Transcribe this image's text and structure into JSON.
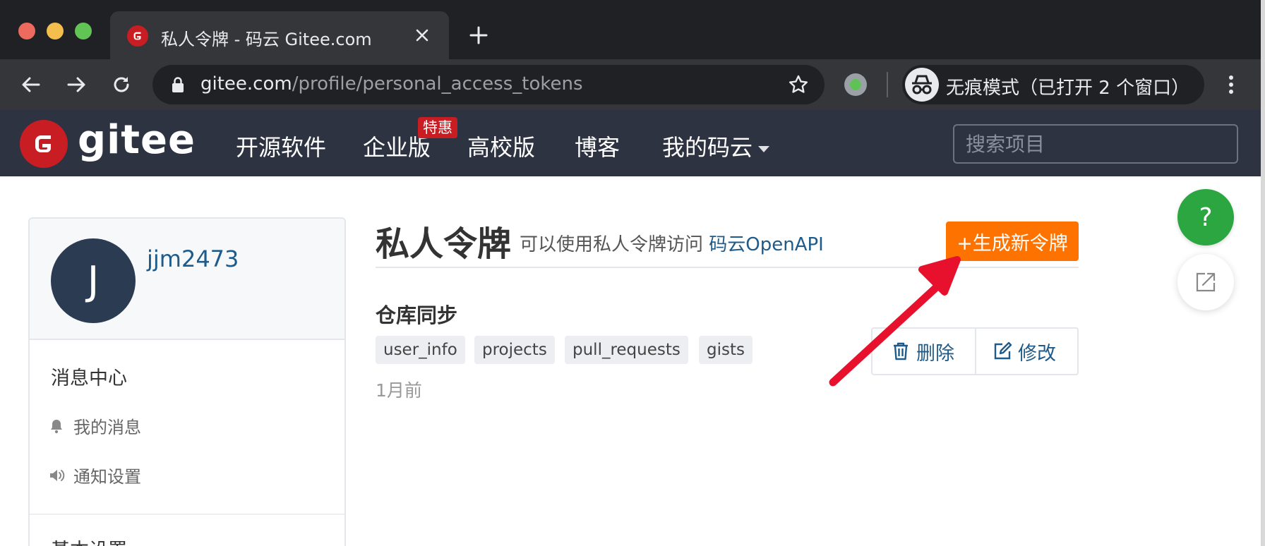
{
  "browser": {
    "tab_title": "私人令牌 - 码云 Gitee.com",
    "url_host": "gitee.com",
    "url_path": "/profile/personal_access_tokens",
    "incognito_label": "无痕模式（已打开 2 个窗口）"
  },
  "site_header": {
    "logo_text": "gitee",
    "nav": [
      "开源软件",
      "企业版",
      "高校版",
      "博客",
      "我的码云"
    ],
    "enterprise_badge": "特惠",
    "search_placeholder": "搜索项目"
  },
  "sidebar": {
    "avatar_initial": "J",
    "username": "jjm2473",
    "sections": [
      "消息中心",
      "基本设置"
    ],
    "items": [
      {
        "label": "我的消息",
        "icon": "bell-icon"
      },
      {
        "label": "通知设置",
        "icon": "speaker-icon"
      }
    ]
  },
  "main": {
    "title": "私人令牌",
    "desc_prefix": "可以使用私人令牌访问 ",
    "desc_link": "码云OpenAPI",
    "new_token_button": "+生成新令牌",
    "token": {
      "name": "仓库同步",
      "scopes": [
        "user_info",
        "projects",
        "pull_requests",
        "gists"
      ],
      "time": "1月前",
      "delete_label": "删除",
      "edit_label": "修改"
    }
  },
  "floating": {
    "help_label": "?"
  },
  "colors": {
    "browser_dark": "#202124",
    "header_bg": "#2e3342",
    "brand_red": "#c71d23",
    "orange_button": "#fe7300",
    "link_blue": "#1f5b8a",
    "help_green": "#2ba640",
    "annotation_arrow": "#e8112d"
  }
}
